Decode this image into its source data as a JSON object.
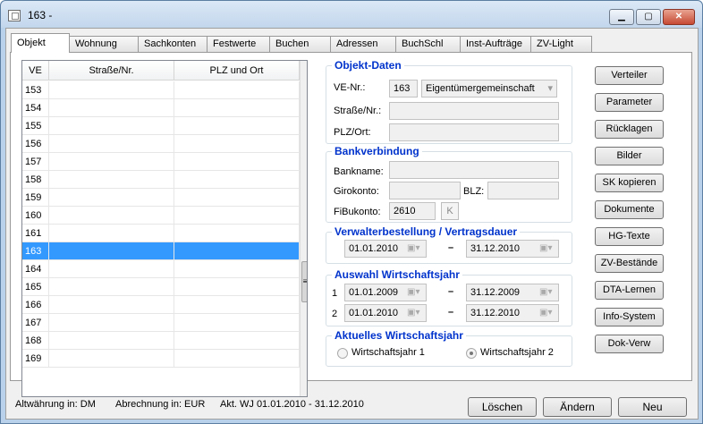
{
  "window": {
    "title": "163 -",
    "buttons": {
      "minimize": "▁",
      "maximize": "▢",
      "close": "✕"
    }
  },
  "tabs": [
    "Objekt",
    "Wohnung",
    "Sachkonten",
    "Festwerte",
    "Buchen",
    "Adressen",
    "BuchSchl",
    "Inst-Aufträge",
    "ZV-Light"
  ],
  "grid": {
    "headers": [
      "VE",
      "Straße/Nr.",
      "PLZ und Ort"
    ],
    "rows": [
      "153",
      "154",
      "155",
      "156",
      "157",
      "158",
      "159",
      "160",
      "161",
      "163",
      "164",
      "165",
      "166",
      "167",
      "168",
      "169"
    ],
    "selected_row": "163",
    "scroll_grip": "≡"
  },
  "objekt_daten": {
    "title": "Objekt-Daten",
    "ve_label": "VE-Nr.:",
    "ve_value": "163",
    "type_value": "Eigentümergemeinschaft",
    "strasse_label": "Straße/Nr.:",
    "strasse_value": "",
    "plz_label": "PLZ/Ort:",
    "plz_value": ""
  },
  "bank": {
    "title": "Bankverbindung",
    "bankname_label": "Bankname:",
    "bankname_value": "",
    "giro_label": "Girokonto:",
    "giro_value": "",
    "blz_label": "BLZ:",
    "blz_value": "",
    "fibu_label": "FiBukonto:",
    "fibu_value": "2610",
    "k_label": "K"
  },
  "verwalter": {
    "title": "Verwalterbestellung / Vertragsdauer",
    "from": "01.01.2010",
    "to": "31.12.2010",
    "dash": "–"
  },
  "wirtschaftsjahr": {
    "title": "Auswahl Wirtschaftsjahr",
    "rows": [
      {
        "num": "1",
        "from": "01.01.2009",
        "to": "31.12.2009"
      },
      {
        "num": "2",
        "from": "01.01.2010",
        "to": "31.12.2010"
      }
    ]
  },
  "aktuell": {
    "title": "Aktuelles Wirtschaftsjahr",
    "opt1": "Wirtschaftsjahr 1",
    "opt2": "Wirtschaftsjahr 2",
    "selected": "Wirtschaftsjahr 2"
  },
  "side_buttons": [
    "Verteiler",
    "Parameter",
    "Rücklagen",
    "Bilder",
    "SK kopieren",
    "Dokumente",
    "HG-Texte",
    "ZV-Bestände",
    "DTA-Lernen",
    "Info-System",
    "Dok-Verw"
  ],
  "status": {
    "altwaehrung": "Altwährung in: DM",
    "abrechnung": "Abrechnung in: EUR",
    "akt_wj": "Akt. WJ  01.01.2010 - 31.12.2010"
  },
  "bottom_buttons": {
    "delete": "Löschen",
    "edit": "Ändern",
    "new": "Neu"
  }
}
